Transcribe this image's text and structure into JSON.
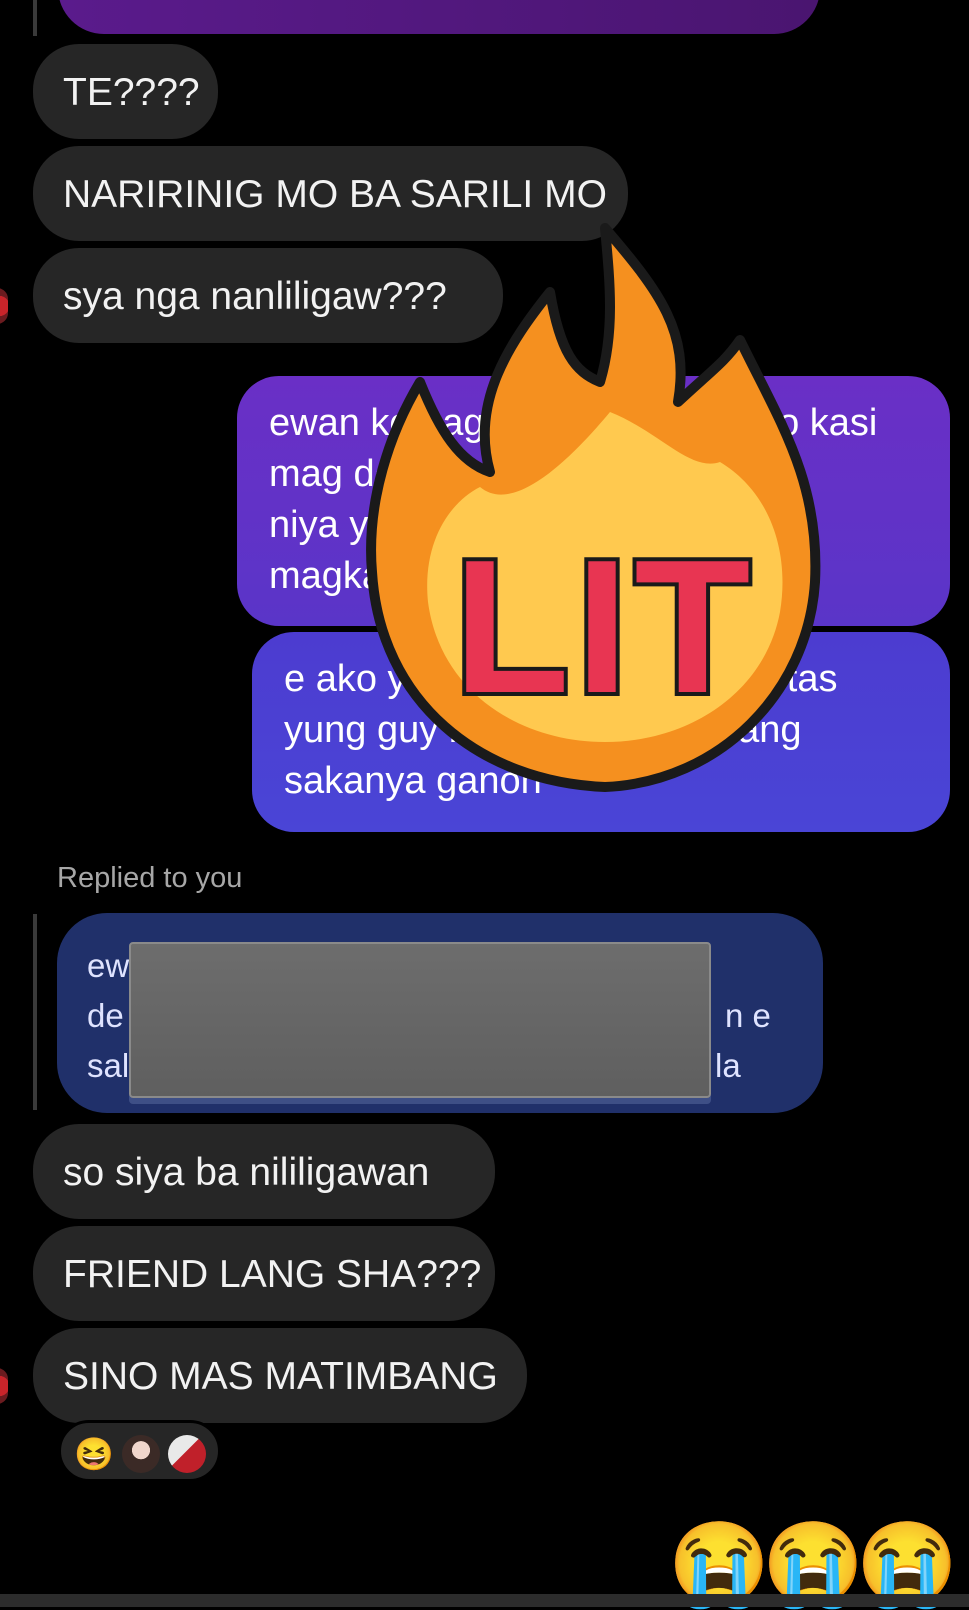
{
  "incoming_top": [
    {
      "text": "TE????"
    },
    {
      "text": "NARIRINIG MO BA SARILI MO"
    },
    {
      "text": "sya nga nanliligaw???"
    }
  ],
  "outgoing": [
    {
      "lines": [
        "ewan ko gaga ewan ko tawa ko kasi",
        "mag de bandang 😭 😭 😭 bff",
        "niya yung guy tas si babae na",
        "magkaibigan"
      ]
    },
    {
      "lines": [
        "e ako yung nagkwento tas ka tas",
        "yung guy naman kasi fren lang",
        "sakanya ganon"
      ]
    }
  ],
  "reply": {
    "label": "Replied to you",
    "quote_lines": [
      "ew",
      "de",
      "sal"
    ],
    "quote_tails": [
      "",
      "n e",
      "la"
    ]
  },
  "incoming_bottom": [
    {
      "text": "so siya ba nililigawan"
    },
    {
      "text": "FRIEND LANG SHA???"
    },
    {
      "text": "SINO MAS MATIMBANG"
    }
  ],
  "sticker": {
    "text": "LIT",
    "icon": "fire-icon"
  },
  "reactions": {
    "emoji": "😆",
    "icons": [
      "laughing-emoji-icon",
      "avatar-reactor-1",
      "avatar-reactor-2"
    ]
  },
  "big_emojis": [
    "😭",
    "😭",
    "😭"
  ],
  "colors": {
    "incoming_bubble": "#262626",
    "outgoing_top": "#6a2fc6",
    "outgoing_bottom": "#4a3fcf",
    "quote_bg": "#20306a",
    "flame_outer": "#f5901f",
    "flame_inner": "#ffc94f",
    "sticker_text": "#e83552"
  }
}
